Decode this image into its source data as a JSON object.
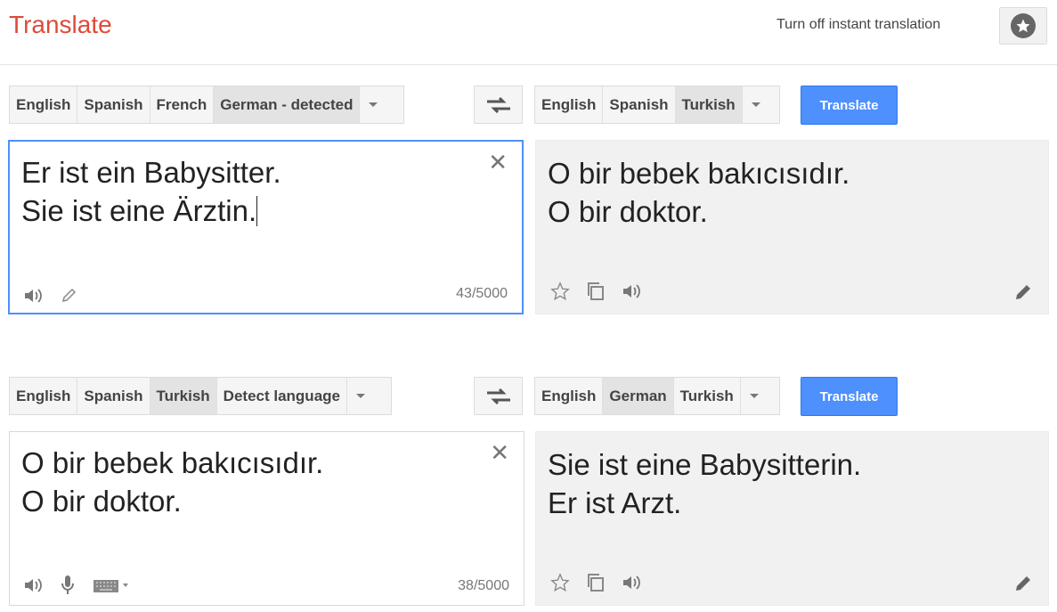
{
  "header": {
    "title": "Translate",
    "instant_link": "Turn off instant translation"
  },
  "panel1": {
    "source_langs": [
      "English",
      "Spanish",
      "French",
      "German - detected"
    ],
    "source_active": "German - detected",
    "target_langs": [
      "English",
      "Spanish",
      "Turkish"
    ],
    "target_active": "Turkish",
    "translate_label": "Translate",
    "source_text": "Er ist ein Babysitter.\nSie ist eine Ärztin.",
    "char_count": "43/5000",
    "result_text": "O bir bebek bakıcısıdır.\nO bir doktor."
  },
  "panel2": {
    "source_langs": [
      "English",
      "Spanish",
      "Turkish",
      "Detect language"
    ],
    "source_active": "Turkish",
    "target_langs": [
      "English",
      "German",
      "Turkish"
    ],
    "target_active": "German",
    "translate_label": "Translate",
    "source_text": "O bir bebek bakıcısıdır.\nO bir doktor.",
    "char_count": "38/5000",
    "result_text": "Sie ist eine Babysitterin.\nEr ist Arzt."
  },
  "colors": {
    "title": "#dd4b39",
    "translate_button": "#4d90fe",
    "focus_border": "#4d90fe",
    "result_background": "#f1f1f1"
  },
  "icons": [
    "star-icon",
    "swap-icon",
    "clear-icon",
    "speaker-icon",
    "pencil-icon",
    "microphone-icon",
    "keyboard-icon",
    "copy-icon"
  ]
}
